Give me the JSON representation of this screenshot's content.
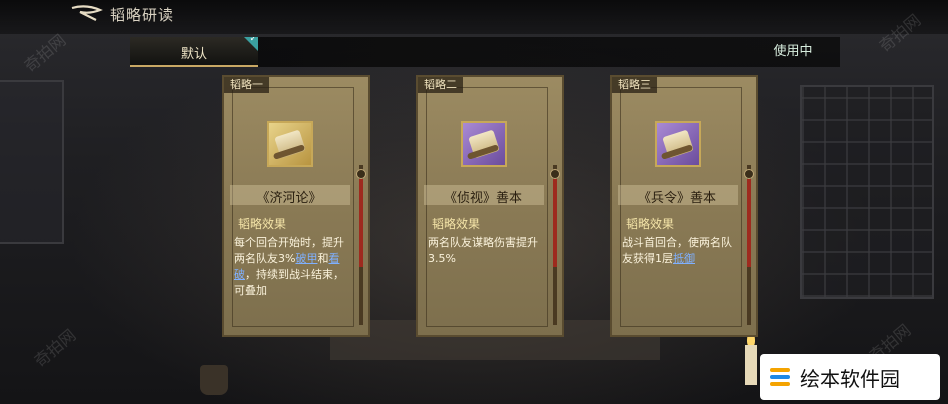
{
  "header": {
    "title": "韬略研读",
    "back_icon": "back-arrow-icon"
  },
  "tabs": {
    "default_label": "默认",
    "default_selected": true,
    "in_use_label": "使用中"
  },
  "cards": [
    {
      "tag": "韬略一",
      "icon": "bamboo-scroll-icon",
      "icon_rarity_color": "#c9a64f",
      "name": "《济河论》",
      "effect_title": "韬略效果",
      "effect_parts": [
        "每个回合开始时，提升两名队友3%",
        "破甲",
        "和",
        "看破",
        "，持续到战斗结束，可叠加"
      ],
      "slider_level": 0.55
    },
    {
      "tag": "韬略二",
      "icon": "scroll-icon",
      "icon_rarity_color": "#8a6bc0",
      "name": "《侦视》善本",
      "effect_title": "韬略效果",
      "effect_parts": [
        "两名队友谋略伤害提升3.5%"
      ],
      "slider_level": 0.55
    },
    {
      "tag": "韬略三",
      "icon": "scroll-icon",
      "icon_rarity_color": "#8a6bc0",
      "name": "《兵令》善本",
      "effect_title": "韬略效果",
      "effect_parts": [
        "战斗首回合，使两名队友获得1层",
        "抵御"
      ],
      "slider_level": 0.55
    }
  ],
  "watermarks": [
    "奇拍网",
    "奇拍网",
    "奇拍网",
    "奇拍网"
  ],
  "logo": {
    "text": "绘本软件园",
    "brand_colors": [
      "#f4a300",
      "#1e88e5"
    ]
  },
  "colors": {
    "accent_gold": "#c9a864",
    "keyword_blue": "#7fb0ff",
    "check_teal": "#3aa0a0"
  }
}
